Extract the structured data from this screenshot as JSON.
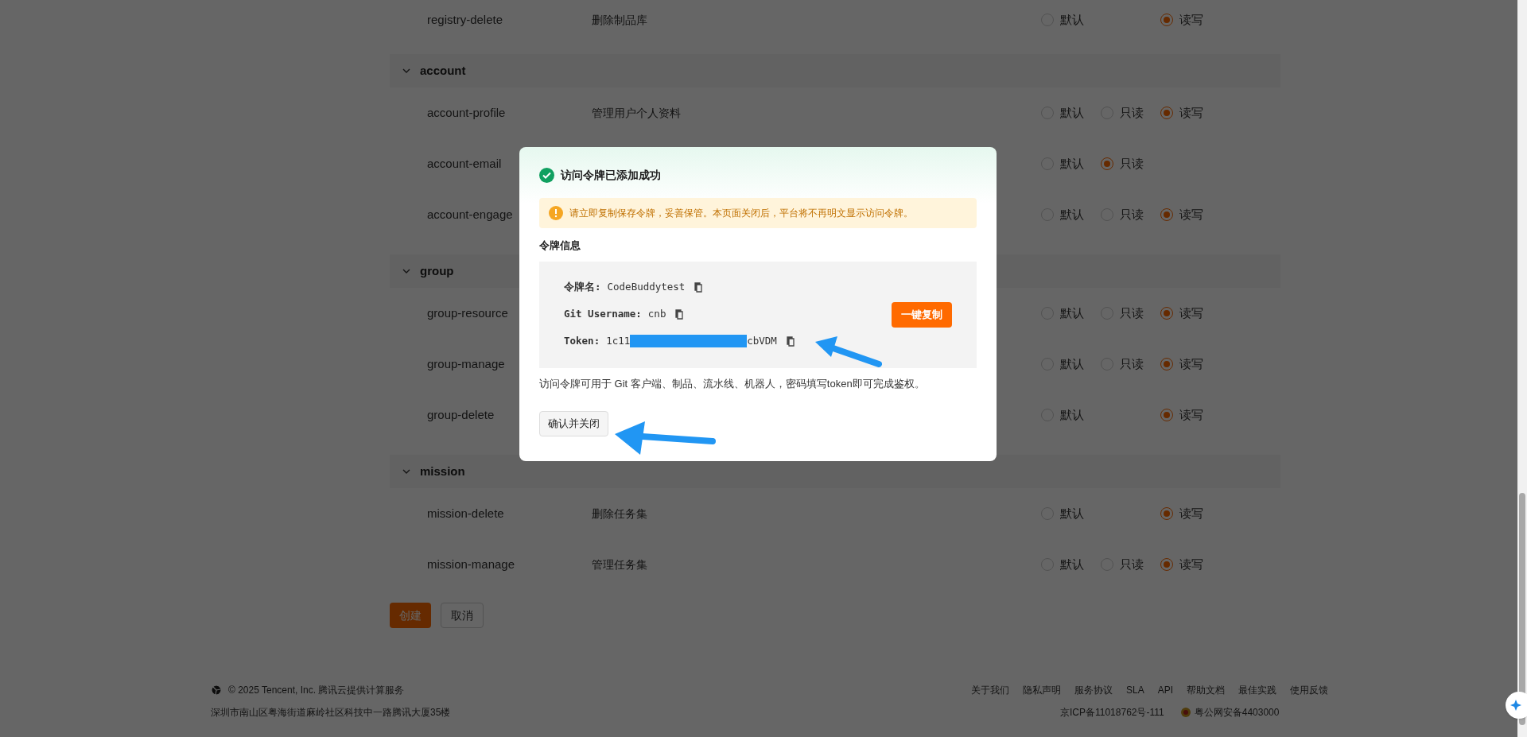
{
  "top_rows": [
    {
      "name": "registry-delete",
      "description": "删除制品库",
      "options": {
        "default": {
          "label": "默认",
          "selected": false
        },
        "readwrite": {
          "label": "读写",
          "selected": true
        }
      }
    }
  ],
  "sections": [
    {
      "title": "account",
      "expanded": true,
      "rows": [
        {
          "name": "account-profile",
          "description": "管理用户个人资料",
          "options": {
            "default": {
              "label": "默认",
              "selected": false
            },
            "readonly": {
              "label": "只读",
              "selected": false
            },
            "readwrite": {
              "label": "读写",
              "selected": true
            }
          }
        },
        {
          "name": "account-email",
          "options": {
            "default": {
              "label": "默认",
              "selected": false
            },
            "readonly": {
              "label": "只读",
              "selected": true
            }
          }
        },
        {
          "name": "account-engage",
          "options": {
            "default": {
              "label": "默认",
              "selected": false
            },
            "readonly": {
              "label": "只读",
              "selected": false
            },
            "readwrite": {
              "label": "读写",
              "selected": true
            }
          }
        }
      ]
    },
    {
      "title": "group",
      "expanded": true,
      "rows": [
        {
          "name": "group-resource",
          "options": {
            "default": {
              "label": "默认",
              "selected": false
            },
            "readonly": {
              "label": "只读",
              "selected": false
            },
            "readwrite": {
              "label": "读写",
              "selected": true
            }
          }
        },
        {
          "name": "group-manage",
          "options": {
            "default": {
              "label": "默认",
              "selected": false
            },
            "readonly": {
              "label": "只读",
              "selected": false
            },
            "readwrite": {
              "label": "读写",
              "selected": true
            }
          }
        },
        {
          "name": "group-delete",
          "options": {
            "default": {
              "label": "默认",
              "selected": false
            },
            "readwrite": {
              "label": "读写",
              "selected": true
            }
          }
        }
      ]
    },
    {
      "title": "mission",
      "expanded": true,
      "rows": [
        {
          "name": "mission-delete",
          "description": "删除任务集",
          "options": {
            "default": {
              "label": "默认",
              "selected": false
            },
            "readwrite": {
              "label": "读写",
              "selected": true
            }
          }
        },
        {
          "name": "mission-manage",
          "description": "管理任务集",
          "options": {
            "default": {
              "label": "默认",
              "selected": false
            },
            "readonly": {
              "label": "只读",
              "selected": false
            },
            "readwrite": {
              "label": "读写",
              "selected": true
            }
          }
        }
      ]
    }
  ],
  "form_buttons": [
    {
      "label": "创建",
      "kind": "primary"
    },
    {
      "label": "取消",
      "kind": "secondary"
    }
  ],
  "footer": {
    "copyright": "© 2025 Tencent, Inc. 腾讯云提供计算服务",
    "address": "深圳市南山区粤海街道麻岭社区科技中一路腾讯大厦35楼",
    "links": [
      "关于我们",
      "隐私声明",
      "服务协议",
      "SLA",
      "API",
      "帮助文档",
      "最佳实践",
      "使用反馈"
    ],
    "icp": "京ICP备11018762号-111",
    "police": "粤公网安备4403000"
  },
  "dialog": {
    "title": "访问令牌已添加成功",
    "warning": "请立即复制保存令牌，妥善保管。本页面关闭后，平台将不再明文显示访问令牌。",
    "section_title": "令牌信息",
    "fields": [
      {
        "label": "令牌名:",
        "value": "CodeBuddytest",
        "redacted": false
      },
      {
        "label": "Git Username:",
        "value": "cnb",
        "redacted": false
      },
      {
        "label": "Token:",
        "value": "1c11",
        "value_end": "cbVDM",
        "redacted": true
      }
    ],
    "copy_all_button": "一键复制",
    "note": "访问令牌可用于 Git 客户端、制品、流水线、机器人，密码填写token即可完成鉴权。",
    "confirm_button": "确认并关闭"
  }
}
